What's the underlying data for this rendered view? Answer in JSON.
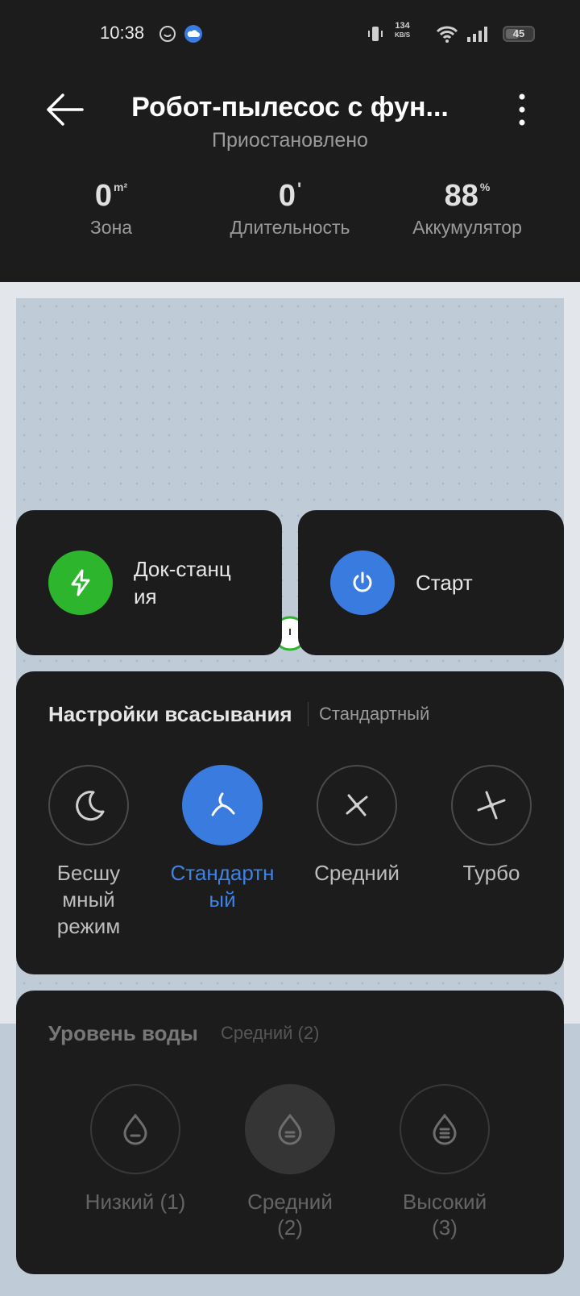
{
  "status_bar": {
    "time": "10:38",
    "network_speed_value": "134",
    "network_speed_unit": "KB/S",
    "battery_level": "45"
  },
  "header": {
    "title": "Робот-пылесос с фун...",
    "subtitle": "Приостановлено"
  },
  "stats": [
    {
      "value": "0",
      "unit": "m²",
      "label": "Зона"
    },
    {
      "value": "0",
      "unit": "'",
      "label": "Длительность"
    },
    {
      "value": "88",
      "unit": "%",
      "label": "Аккумулятор"
    }
  ],
  "actions": {
    "dock": {
      "label_line1": "Док-станц",
      "label_line2": "ия",
      "color": "#2db52d",
      "icon": "lightning-icon"
    },
    "start": {
      "label": "Старт",
      "color": "#3a7be0",
      "icon": "power-icon"
    }
  },
  "suction": {
    "title": "Настройки всасывания",
    "current": "Стандартный",
    "modes": [
      {
        "label_lines": [
          "Бесшу",
          "мный",
          "режим"
        ],
        "icon": "moon-icon",
        "active": false
      },
      {
        "label_lines": [
          "Стандартн",
          "ый"
        ],
        "icon": "fan-icon",
        "active": true
      },
      {
        "label_lines": [
          "Средний"
        ],
        "icon": "fan-medium-icon",
        "active": false
      },
      {
        "label_lines": [
          "Турбо"
        ],
        "icon": "fan-turbo-icon",
        "active": false
      }
    ]
  },
  "water": {
    "title": "Уровень воды",
    "current": "Средний (2)",
    "levels": [
      {
        "label_lines": [
          "Низкий (1)"
        ],
        "icon": "drop-low-icon",
        "active": false
      },
      {
        "label_lines": [
          "Средний",
          "(2)"
        ],
        "icon": "drop-medium-icon",
        "active": true
      },
      {
        "label_lines": [
          "Высокий",
          "(3)"
        ],
        "icon": "drop-high-icon",
        "active": false
      }
    ]
  },
  "colors": {
    "accent": "#3a7be0",
    "dock_green": "#2db52d",
    "card_bg": "#1c1c1c",
    "map_bg": "#c0cbd8"
  }
}
